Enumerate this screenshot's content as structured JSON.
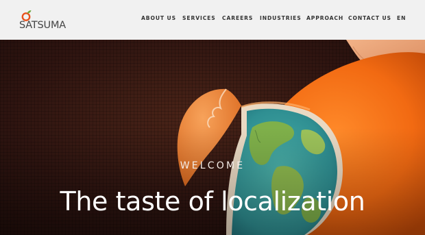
{
  "brand": {
    "name": "SATSUMA",
    "accent_color": "#e8521c",
    "leaf_color": "#6aa63c"
  },
  "nav": {
    "items": [
      {
        "label": "ABOUT US"
      },
      {
        "label": "SERVICES"
      },
      {
        "label": "CAREERS"
      },
      {
        "label": "INDUSTRIES"
      },
      {
        "label": "APPROACH"
      },
      {
        "label": "CONTACT US"
      }
    ],
    "language": "EN"
  },
  "hero": {
    "eyebrow": "WELCOME",
    "title": "The taste of localization",
    "image_subject": "orange-peel-globe"
  }
}
